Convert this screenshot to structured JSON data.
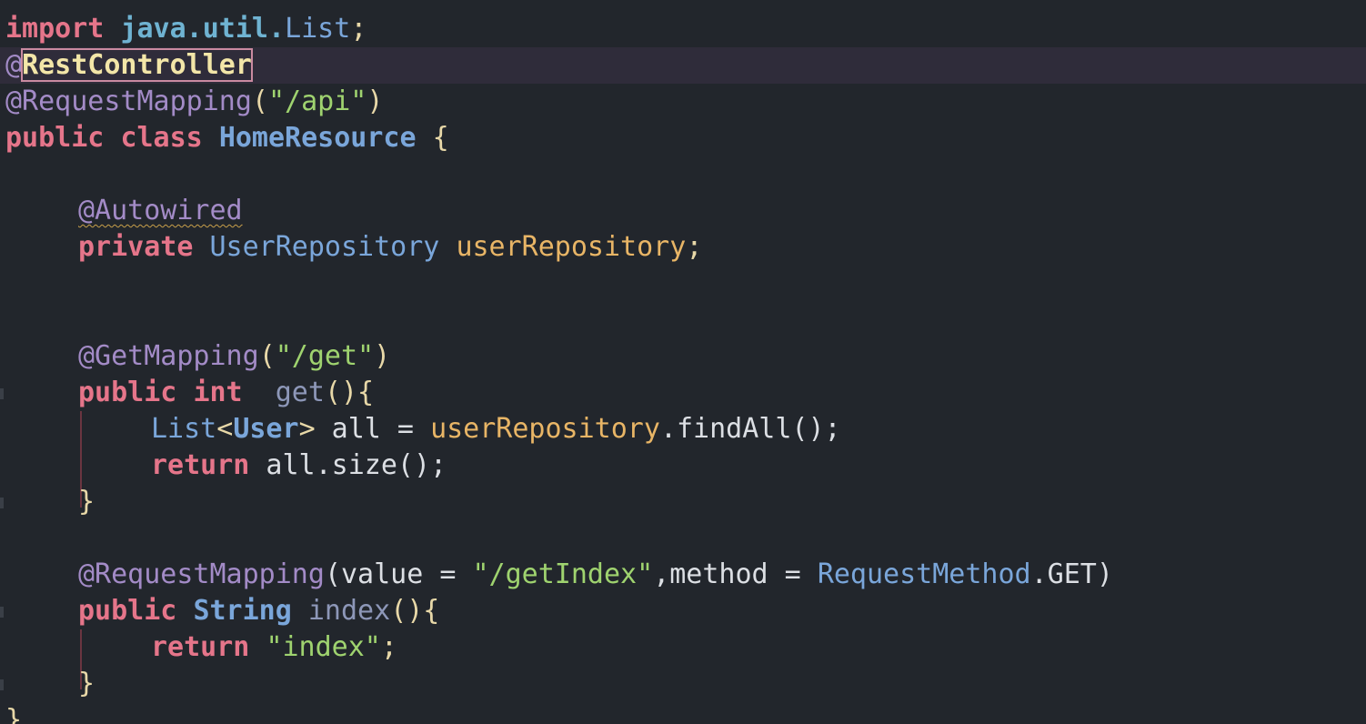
{
  "code": {
    "l1": {
      "kw": "import",
      "pkg": "java.util.",
      "type": "List",
      "end": ";"
    },
    "l2": {
      "at": "@",
      "ann": "RestController"
    },
    "l3": {
      "ann": "@RequestMapping",
      "open": "(",
      "str": "\"/api\"",
      "close": ")"
    },
    "l4": {
      "kw1": "public",
      "kw2": "class",
      "name": "HomeResource",
      "brace": "{"
    },
    "l6": {
      "ann": "@Autowired"
    },
    "l7": {
      "kw": "private",
      "type": "UserRepository",
      "field": "userRepository",
      "end": ";"
    },
    "l10": {
      "ann": "@GetMapping",
      "open": "(",
      "str": "\"/get\"",
      "close": ")"
    },
    "l11": {
      "kw1": "public",
      "kw2": "int",
      "fn": "get",
      "rest": "(){"
    },
    "l12": {
      "type": "List",
      "lt": "<",
      "generic": "User",
      "gt": ">",
      "var": " all = ",
      "field": "userRepository",
      "call": ".findAll();"
    },
    "l13": {
      "kw": "return",
      "rest": " all.size();"
    },
    "l14": {
      "brace": "}"
    },
    "l16": {
      "ann": "@RequestMapping",
      "a": "(value = ",
      "str": "\"/getIndex\"",
      "b": ",method = ",
      "type": "RequestMethod",
      "c": ".GET)"
    },
    "l17": {
      "kw": "public",
      "type": "String",
      "fn": "index",
      "rest": "(){"
    },
    "l18": {
      "kw": "return",
      "str": "\"index\"",
      "end": ";"
    },
    "l19": {
      "brace": "}"
    },
    "l20": {
      "brace": "}"
    }
  },
  "colors": {
    "background": "#22262c",
    "current_line": "#2f2c3a",
    "keyword": "#e5758a",
    "annotation": "#a38bc7",
    "string": "#9fd36f",
    "field": "#e8b566",
    "type": "#7aa6da"
  }
}
